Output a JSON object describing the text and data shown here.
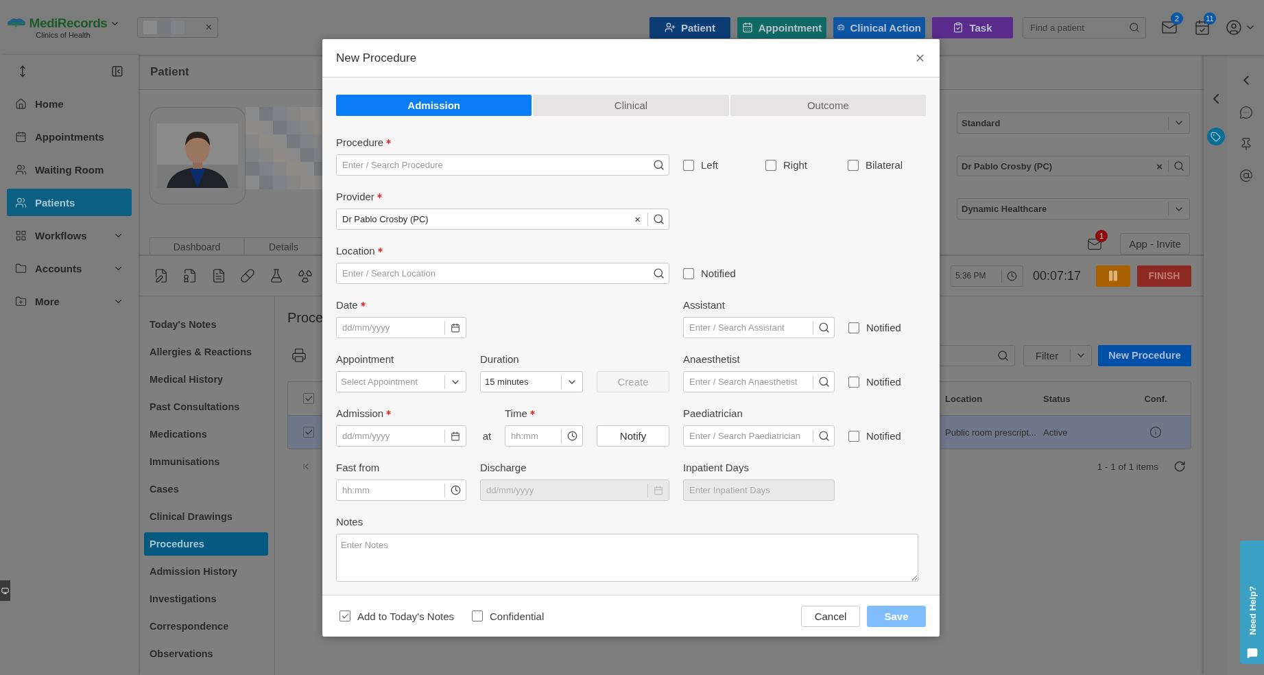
{
  "brand": {
    "name": "MediRecords",
    "subtitle": "Clinics of Health"
  },
  "top_bar": {
    "patient_chip": {
      "close": "×"
    },
    "actions": [
      {
        "label": "Patient",
        "kind": "patient",
        "color": "#0b3c74"
      },
      {
        "label": "Appointment",
        "kind": "appointment",
        "color": "#0f6966"
      },
      {
        "label": "Clinical Action",
        "kind": "clinical",
        "color": "#0c56a3"
      },
      {
        "label": "Task",
        "kind": "task",
        "color": "#5a2b8b"
      }
    ],
    "search": {
      "placeholder": "Find a patient"
    },
    "messages_badge": "2",
    "tasks_badge": "11"
  },
  "sidebar": {
    "items": [
      {
        "label": "Home",
        "kind": "home",
        "selected": false,
        "expandable": false
      },
      {
        "label": "Appointments",
        "kind": "calendar",
        "selected": false,
        "expandable": false
      },
      {
        "label": "Waiting Room",
        "kind": "people",
        "selected": false,
        "expandable": false
      },
      {
        "label": "Patients",
        "kind": "people",
        "selected": true,
        "expandable": false
      },
      {
        "label": "Workflows",
        "kind": "grid",
        "selected": false,
        "expandable": true
      },
      {
        "label": "Accounts",
        "kind": "folder",
        "selected": false,
        "expandable": true
      },
      {
        "label": "More",
        "kind": "folder-plus",
        "selected": false,
        "expandable": true
      }
    ]
  },
  "page": {
    "title": "Patient",
    "patient_tabs": [
      {
        "label": "Dashboard"
      },
      {
        "label": "Details"
      }
    ],
    "settings": [
      {
        "kind": "select",
        "value": "Standard"
      },
      {
        "kind": "search",
        "value": "Dr Pablo Crosby (PC)",
        "clear": "×"
      },
      {
        "kind": "select",
        "value": "Dynamic Healthcare"
      }
    ],
    "inbox_badge": "1",
    "invite_button": "App - Invite",
    "session": {
      "time": "5:36 PM",
      "elapsed": "00:07:17",
      "finish": "FINISH"
    },
    "record_menu": [
      {
        "label": "Today's Notes",
        "selected": false
      },
      {
        "label": "Allergies & Reactions",
        "selected": false
      },
      {
        "label": "Medical History",
        "selected": false
      },
      {
        "label": "Past Consultations",
        "selected": false
      },
      {
        "label": "Medications",
        "selected": false
      },
      {
        "label": "Immunisations",
        "selected": false
      },
      {
        "label": "Cases",
        "selected": false
      },
      {
        "label": "Clinical Drawings",
        "selected": false
      },
      {
        "label": "Procedures",
        "selected": true
      },
      {
        "label": "Admission History",
        "selected": false
      },
      {
        "label": "Investigations",
        "selected": false
      },
      {
        "label": "Correspondence",
        "selected": false
      },
      {
        "label": "Observations",
        "selected": false
      }
    ],
    "section_title": "Proce",
    "filter_button": "Filter",
    "new_button": "New Procedure",
    "table": {
      "all_checked": true,
      "columns": [
        "Location",
        "Status",
        "Conf."
      ],
      "rows": [
        {
          "location": "Public room prescript...",
          "status": "Active",
          "checked": true,
          "selected": true
        }
      ]
    },
    "pagination": "1 - 1 of 1 items"
  },
  "help_tab": "Need Help?",
  "dialog": {
    "title": "New Procedure",
    "tabs": [
      {
        "label": "Admission",
        "selected": true
      },
      {
        "label": "Clinical",
        "selected": false
      },
      {
        "label": "Outcome",
        "selected": false
      }
    ],
    "procedure": {
      "label": "Procedure",
      "required": true,
      "placeholder": "Enter / Search Procedure"
    },
    "sides": [
      {
        "label": "Left",
        "checked": false
      },
      {
        "label": "Right",
        "checked": false
      },
      {
        "label": "Bilateral",
        "checked": false
      }
    ],
    "provider": {
      "label": "Provider",
      "required": true,
      "value": "Dr Pablo Crosby (PC)",
      "clear": "×"
    },
    "location": {
      "label": "Location",
      "required": true,
      "placeholder": "Enter / Search Location",
      "notified": {
        "label": "Notified",
        "checked": false
      }
    },
    "date": {
      "label": "Date",
      "required": true,
      "placeholder": "dd/mm/yyyy"
    },
    "staff": [
      {
        "label": "Assistant",
        "placeholder": "Enter / Search Assistant",
        "notified": {
          "label": "Notified",
          "checked": false
        }
      },
      {
        "label": "Anaesthetist",
        "placeholder": "Enter / Search Anaesthetist",
        "notified": {
          "label": "Notified",
          "checked": false
        }
      },
      {
        "label": "Paediatrician",
        "placeholder": "Enter / Search Paediatrician",
        "notified": {
          "label": "Notified",
          "checked": false
        }
      }
    ],
    "appointment": {
      "label": "Appointment",
      "placeholder": "Select Appointment"
    },
    "duration": {
      "label": "Duration",
      "value": "15 minutes"
    },
    "create_button": {
      "label": "Create",
      "disabled": true
    },
    "admission": {
      "label": "Admission",
      "required": true,
      "placeholder": "dd/mm/yyyy"
    },
    "at_text": "at",
    "time": {
      "label": "Time",
      "required": true,
      "placeholder": "hh:mm"
    },
    "notify_button": "Notify",
    "fast_from": {
      "label": "Fast from",
      "placeholder": "hh:mm"
    },
    "discharge": {
      "label": "Discharge",
      "placeholder": "dd/mm/yyyy",
      "disabled": true
    },
    "inpatient_days": {
      "label": "Inpatient Days",
      "placeholder": "Enter Inpatient Days",
      "disabled": true
    },
    "notes": {
      "label": "Notes",
      "placeholder": "Enter Notes"
    },
    "footer_checks": [
      {
        "label": "Add to Today's Notes",
        "checked": true
      },
      {
        "label": "Confidential",
        "checked": false
      }
    ],
    "cancel_button": "Cancel",
    "save_button": {
      "label": "Save",
      "disabled": true
    }
  }
}
